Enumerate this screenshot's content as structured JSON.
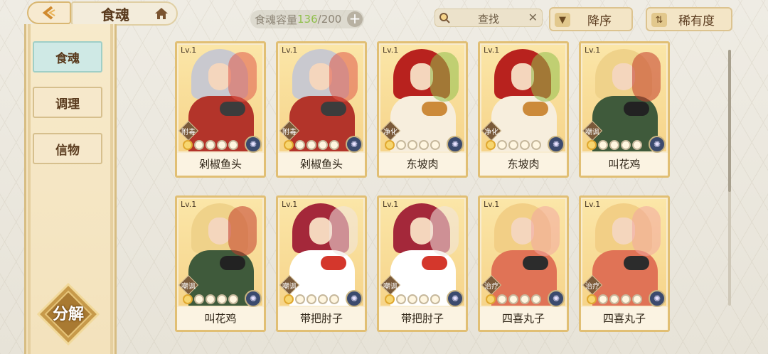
{
  "header": {
    "title": "食魂",
    "capacity_label": "食魂容量",
    "capacity_current": "136",
    "capacity_max": "/200",
    "search_placeholder": "查找",
    "sort_order_label": "降序",
    "sort_by_label": "稀有度"
  },
  "sidebar": {
    "items": [
      {
        "label": "食魂",
        "active": true
      },
      {
        "label": "调理",
        "active": false
      },
      {
        "label": "信物",
        "active": false
      }
    ],
    "decompose_label": "分解"
  },
  "cards": [
    {
      "level": "Lv.1",
      "name": "剁椒鱼头",
      "tag": "附毒",
      "stars": 1,
      "palette": [
        "#c9c9cf",
        "#b3342a",
        "#3c3c3c",
        "#e05a4a"
      ]
    },
    {
      "level": "Lv.1",
      "name": "剁椒鱼头",
      "tag": "附毒",
      "stars": 1,
      "palette": [
        "#c9c9cf",
        "#b3342a",
        "#3c3c3c",
        "#e05a4a"
      ]
    },
    {
      "level": "Lv.1",
      "name": "东坡肉",
      "tag": "净化",
      "stars": 1,
      "palette": [
        "#b8221e",
        "#f7eedd",
        "#cc8a3a",
        "#8fbf4a"
      ]
    },
    {
      "level": "Lv.1",
      "name": "东坡肉",
      "tag": "净化",
      "stars": 1,
      "palette": [
        "#b8221e",
        "#f7eedd",
        "#cc8a3a",
        "#8fbf4a"
      ]
    },
    {
      "level": "Lv.1",
      "name": "叫花鸡",
      "tag": "嘲讽",
      "stars": 1,
      "palette": [
        "#efd28a",
        "#3f5a3b",
        "#222222",
        "#c23a2a"
      ]
    },
    {
      "level": "Lv.1",
      "name": "叫花鸡",
      "tag": "嘲讽",
      "stars": 1,
      "palette": [
        "#efd28a",
        "#3f5a3b",
        "#222222",
        "#c23a2a"
      ]
    },
    {
      "level": "Lv.1",
      "name": "带把肘子",
      "tag": "嘲讽",
      "stars": 1,
      "palette": [
        "#a4283a",
        "#ffffff",
        "#d4372c",
        "#f0e6e0"
      ]
    },
    {
      "level": "Lv.1",
      "name": "带把肘子",
      "tag": "嘲讽",
      "stars": 1,
      "palette": [
        "#a4283a",
        "#ffffff",
        "#d4372c",
        "#f0e6e0"
      ]
    },
    {
      "level": "Lv.1",
      "name": "四喜丸子",
      "tag": "治疗",
      "stars": 1,
      "palette": [
        "#f2cf86",
        "#e07356",
        "#2c2c2c",
        "#f3a8a0"
      ]
    },
    {
      "level": "Lv.1",
      "name": "四喜丸子",
      "tag": "治疗",
      "stars": 1,
      "palette": [
        "#f2cf86",
        "#e07356",
        "#2c2c2c",
        "#f3a8a0"
      ]
    }
  ]
}
